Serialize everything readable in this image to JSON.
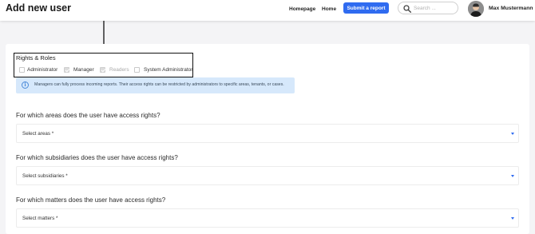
{
  "header": {
    "page_title": "Add new user",
    "nav": [
      "Homepage",
      "Home"
    ],
    "submit_label": "Submit a report",
    "search_placeholder": "Search ...",
    "user_name": "Max Mustermann"
  },
  "roles": {
    "title": "Rights & Roles",
    "options": [
      {
        "label": "Administrator",
        "checked": false,
        "disabled": false
      },
      {
        "label": "Manager",
        "checked": true,
        "disabled": false
      },
      {
        "label": "Readers",
        "checked": true,
        "disabled": true
      },
      {
        "label": "System Administrator",
        "checked": false,
        "disabled": false
      }
    ]
  },
  "info": {
    "text": "Managers can fully process incoming reports. Their access rights can be restricted by administrators to specific areas, tenants, or cases."
  },
  "sections": [
    {
      "question": "For which areas does the user have access rights?",
      "select": "Select areas *"
    },
    {
      "question": "For which subsidiaries does the user have access rights?",
      "select": "Select subsidiaries *"
    },
    {
      "question": "For which matters does the user have access rights?",
      "select": "Select matters *"
    }
  ],
  "colors": {
    "accent": "#2f6bf0",
    "info_background": "#d6e8fb",
    "info_icon": "#4a8ad9"
  }
}
